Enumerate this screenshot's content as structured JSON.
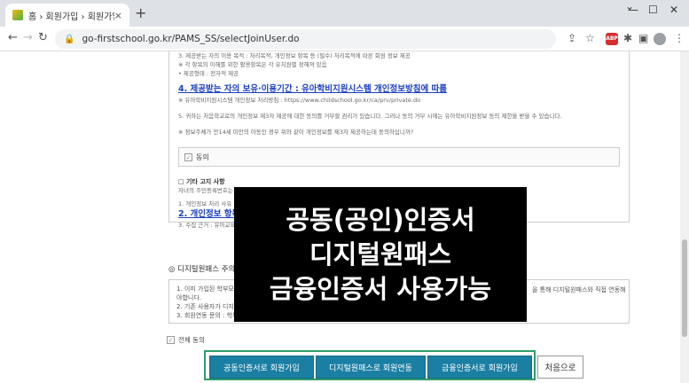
{
  "browser": {
    "tab_title": "홈 › 회원가입 › 회원가입",
    "tab_close": "×",
    "new_tab": "+",
    "url": "go-firstschool.go.kr/PAMS_SS/selectJoinUser.do",
    "window_controls": [
      "—",
      "☐",
      "✕"
    ],
    "extension_badge": "ABP"
  },
  "privacy": {
    "top_line_1": "3. 제공받는 자의 이용 목적 : 처리목적, 개인정보 항목 등 (필수) 처리목적에 따른 회원 정보 제공",
    "top_line_2": "※ 각 항목의 이해를 위한 활용항목은 각 유치원별 정해져 있음",
    "top_line_3": "• 제공형태 : 전자적 제공",
    "section4_title": "4. 제공받는 자의 보유·이용기간 : 유아학비지원시스템 개인정보방침에 따름",
    "section4_link": "※ 유아학비지원시스템 개인정보 처리방침 : https://www.childschool.go.kr/ca/prv/private.do",
    "refusal_text": "5. 귀하는 처음학교로의 개인정보 제3자 제공에 대한 동의를 거부할 권리가 있습니다. 그러나 동의 거부 시에는 유아학비지원정보 동의 제한을 받을 수 있습니다.",
    "age_text": "※ 정보주체가 만14세 미만의 아동인 경우 위와 같이 개인정보를 제3자 제공하는데 동의하십니까?",
    "agree_label": "동의",
    "other_title": "□ 기타 고지 사항",
    "other_text": "자녀의 주민등록번호는 관련 법령에 따라 정보주체의 동의 없이 개인정보를 수집·이용합니다.",
    "other_item_1": "1. 개인정보 처리 사유 : 유치원 입학 관련 서비스 제공",
    "section2_title": "2. 개인정보 항목 : 주민등록번호",
    "other_item_3": "3. 수집 근거 : 유아교육법 시행령"
  },
  "digital_pass": {
    "title": "◎ 디지털원패스 주의사항",
    "line1": "1. 이미 가입된 학부모님은",
    "line1_right": "을 통해 디지털원패스와 직접 연동해",
    "line1_cont": "야합니다.",
    "line2": "2. 기존 사용자가 디지털원패스를 이용하는 경우",
    "line3": "3. 회원연동 문의 : 학부모콜센터(1544-0079 9-1)"
  },
  "all_agree_label": "전체 동의",
  "buttons": {
    "cert_join": "공동인증서로 회원가입",
    "digital_link": "디지털원패스로 회원연동",
    "finance_join": "금융인증서로 회원가입",
    "start_over": "처음으로"
  },
  "overlay": {
    "line1": "공동(공인)인증서",
    "line2": "디지털원패스",
    "line3": "금융인증서 사용가능"
  }
}
